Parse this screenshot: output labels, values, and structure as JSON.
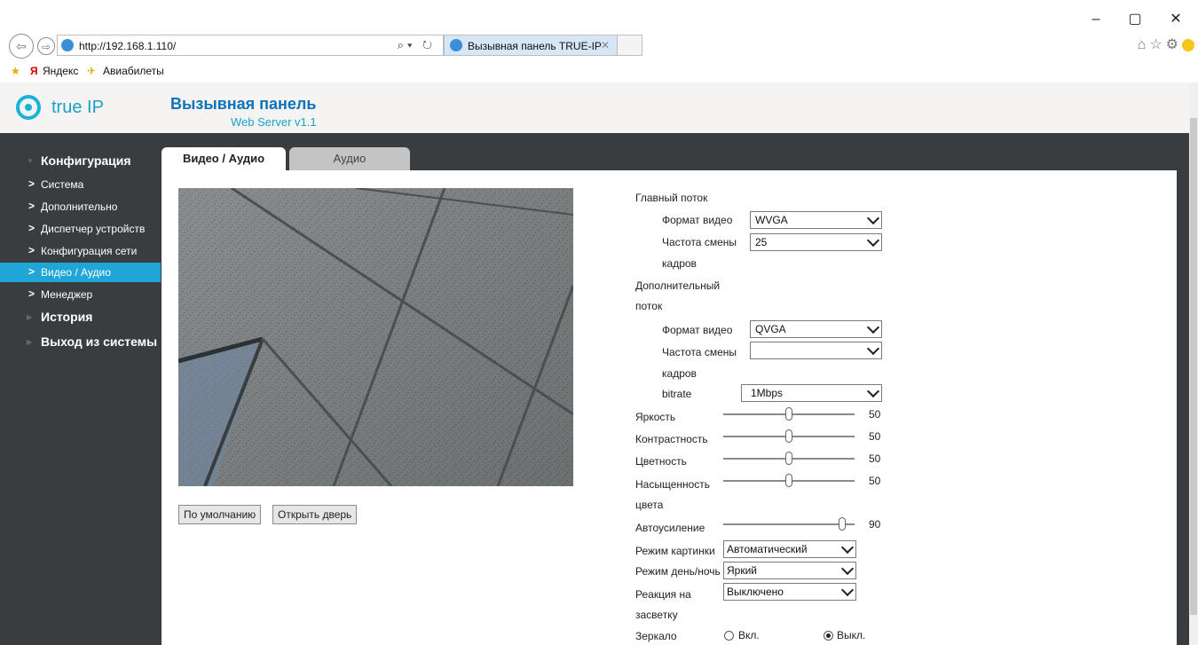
{
  "browser": {
    "url": "http://192.168.1.110/",
    "tab_title": "Вызывная панель TRUE-IP",
    "favorites": [
      "Яндекс",
      "Авиабилеты"
    ]
  },
  "header": {
    "logo": "true IP",
    "title": "Вызывная панель",
    "subtitle": "Web Server v1.1"
  },
  "sidebar": {
    "groups": [
      {
        "label": "Конфигурация"
      },
      {
        "label": "История"
      },
      {
        "label": "Выход из системы"
      }
    ],
    "items": [
      {
        "label": "Система"
      },
      {
        "label": "Дополнительно"
      },
      {
        "label": "Диспетчер устройств"
      },
      {
        "label": "Конфигурация сети"
      },
      {
        "label": "Видео / Аудио",
        "active": true
      },
      {
        "label": "Менеджер"
      }
    ]
  },
  "tabs": [
    {
      "label": "Видео / Аудио",
      "active": true
    },
    {
      "label": "Аудио",
      "active": false
    }
  ],
  "buttons": {
    "default": "По умолчанию",
    "open_door": "Открыть дверь"
  },
  "settings": {
    "main_stream": "Главный поток",
    "main_format_label": "Формат видео",
    "main_format": "WVGA",
    "main_fps_label1": "Частота смены",
    "main_fps_label2": "кадров",
    "main_fps": "25",
    "sub_stream1": "Дополнительный",
    "sub_stream2": "поток",
    "sub_format_label": "Формат видео",
    "sub_format": "QVGA",
    "sub_fps_label1": "Частота смены",
    "sub_fps_label2": "кадров",
    "sub_fps": "",
    "bitrate_label": "bitrate",
    "bitrate": "1Mbps",
    "brightness_label": "Яркость",
    "brightness": "50",
    "contrast_label": "Контрастность",
    "contrast": "50",
    "color_label": "Цветность",
    "color": "50",
    "saturation_label1": "Насыщенность",
    "saturation_label2": "цвета",
    "saturation": "50",
    "agc_label": "Автоусиление",
    "agc": "90",
    "picture_mode_label": "Режим картинки",
    "picture_mode": "Автоматический",
    "daynight_label": "Режим день/ночь",
    "daynight": "Яркий",
    "backlight_label1": "Реакция на",
    "backlight_label2": "засветку",
    "backlight": "Выключено",
    "mirror_label": "Зеркало",
    "mirror_on": "Вкл.",
    "mirror_off": "Выкл."
  }
}
